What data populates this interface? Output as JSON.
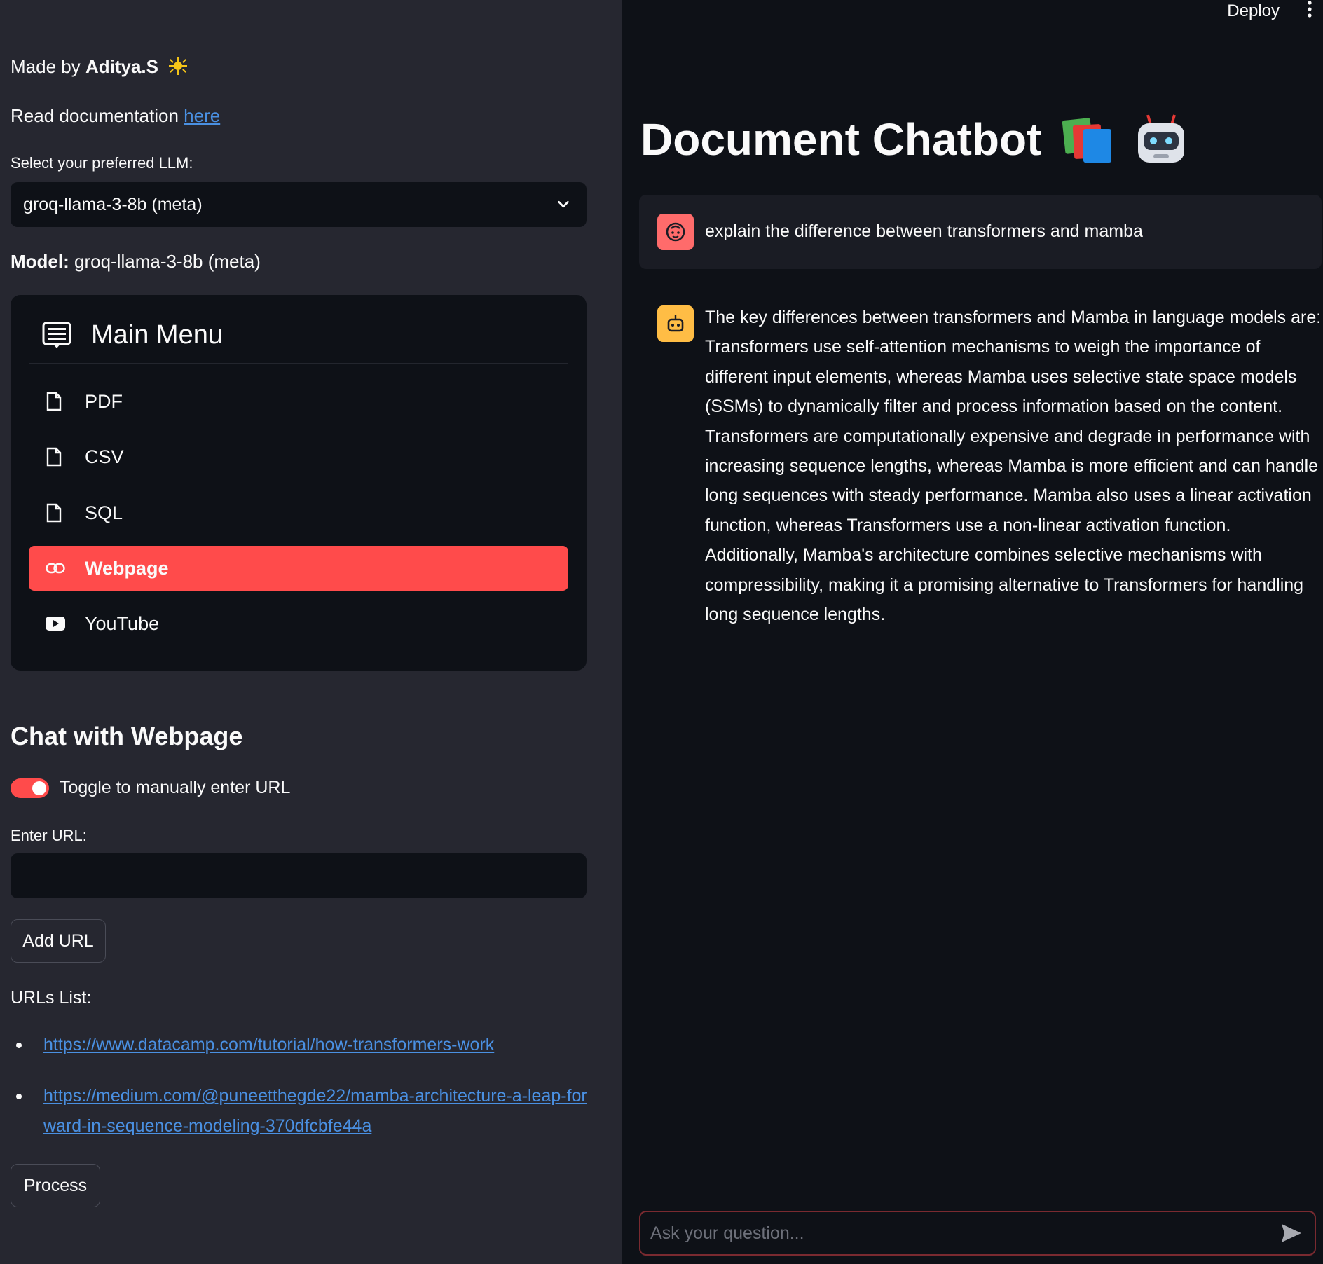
{
  "sidebar": {
    "made_by_prefix": "Made by ",
    "made_by_name": "Aditya.S",
    "read_doc_prefix": "Read documentation ",
    "read_doc_link": "here",
    "llm_label": "Select your preferred LLM:",
    "llm_selected": "groq-llama-3-8b (meta)",
    "model_label": "Model:",
    "model_value": " groq-llama-3-8b (meta)",
    "menu": {
      "title": "Main Menu",
      "items": [
        {
          "label": "PDF",
          "icon": "file-icon"
        },
        {
          "label": "CSV",
          "icon": "file-icon"
        },
        {
          "label": "SQL",
          "icon": "file-icon"
        },
        {
          "label": "Webpage",
          "icon": "link-icon",
          "active": true
        },
        {
          "label": "YouTube",
          "icon": "youtube-icon"
        }
      ]
    },
    "section_title": "Chat with Webpage",
    "toggle_label": "Toggle to manually enter URL",
    "url_label": "Enter URL:",
    "url_value": "",
    "add_url_label": "Add URL",
    "urls_list_label": "URLs List:",
    "urls": [
      "https://www.datacamp.com/tutorial/how-transformers-work",
      "https://medium.com/@puneetthegde22/mamba-architecture-a-leap-forward-in-sequence-modeling-370dfcbfe44a"
    ],
    "process_label": "Process"
  },
  "main": {
    "deploy_label": "Deploy",
    "title": "Document Chatbot",
    "title_emojis": [
      "books-icon",
      "robot-icon"
    ],
    "messages": [
      {
        "role": "user",
        "text": "explain the difference between transformers and mamba"
      },
      {
        "role": "assistant",
        "text": "The key differences between transformers and Mamba in language models are: Transformers use self-attention mechanisms to weigh the importance of different input elements, whereas Mamba uses selective state space models (SSMs) to dynamically filter and process information based on the content. Transformers are computationally expensive and degrade in performance with increasing sequence lengths, whereas Mamba is more efficient and can handle long sequences with steady performance. Mamba also uses a linear activation function, whereas Transformers use a non-linear activation function. Additionally, Mamba's architecture combines selective mechanisms with compressibility, making it a promising alternative to Transformers for handling long sequence lengths."
      }
    ],
    "chat_placeholder": "Ask your question..."
  },
  "colors": {
    "accent": "#ff4b4b",
    "sidebar_bg": "#262730",
    "main_bg": "#0e1117",
    "link": "#4a90e2",
    "bot_avatar": "#ffbd45"
  }
}
